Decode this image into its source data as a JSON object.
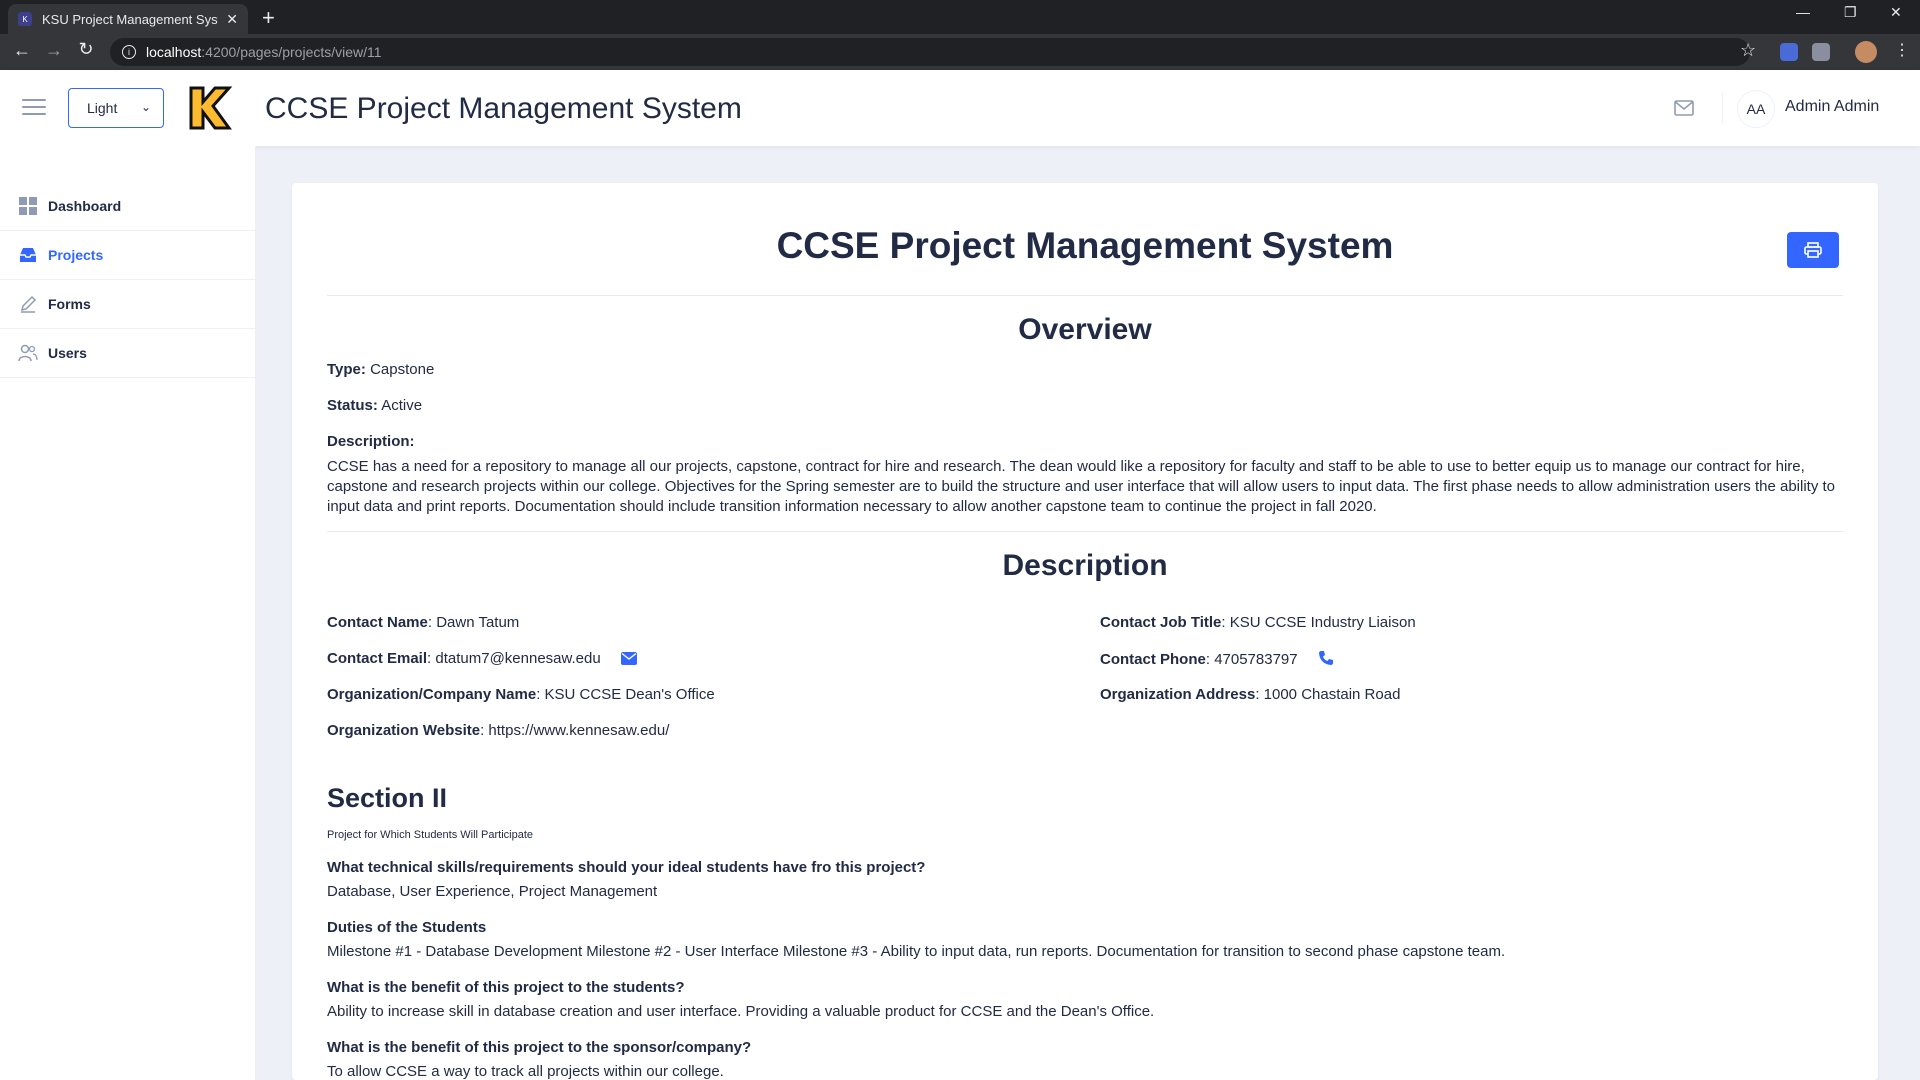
{
  "browser": {
    "tab_title": "KSU Project Management System",
    "url_host": "localhost",
    "url_path": ":4200/pages/projects/view/11"
  },
  "header": {
    "theme_value": "Light",
    "app_title": "CCSE Project Management System",
    "user_initials": "AA",
    "user_name": "Admin Admin"
  },
  "sidebar": {
    "items": [
      {
        "label": "Dashboard",
        "icon": "grid-icon"
      },
      {
        "label": "Projects",
        "icon": "inbox-icon"
      },
      {
        "label": "Forms",
        "icon": "edit-icon"
      },
      {
        "label": "Users",
        "icon": "people-icon"
      }
    ]
  },
  "project": {
    "title": "CCSE Project Management System",
    "overview_heading": "Overview",
    "type_label": "Type:",
    "type_value": "Capstone",
    "status_label": "Status:",
    "status_value": "Active",
    "description_label": "Description:",
    "description_text": "CCSE has a need for a repository to manage all our projects, capstone, contract for hire and research. The dean would like a repository for faculty and staff to be able to use to better equip us to manage our contract for hire, capstone and research projects within our college. Objectives for the Spring semester are to build the structure and user interface that will allow users to input data. The first phase needs to allow administration users the ability to input data and print reports. Documentation should include transition information necessary to allow another capstone team to continue the project in fall 2020.",
    "description_heading": "Description",
    "contact": {
      "name_label": "Contact Name",
      "name_value": "Dawn Tatum",
      "job_label": "Contact Job Title",
      "job_value": "KSU CCSE Industry Liaison",
      "email_label": "Contact Email",
      "email_value": "dtatum7@kennesaw.edu",
      "phone_label": "Contact Phone",
      "phone_value": "4705783797",
      "org_label": "Organization/Company Name",
      "org_value": "KSU CCSE Dean's Office",
      "address_label": "Organization Address",
      "address_value": "1000 Chastain Road",
      "website_label": "Organization Website",
      "website_value": "https://www.kennesaw.edu/"
    },
    "section2": {
      "heading": "Section II",
      "subheading": "Project for Which Students Will Participate",
      "qa": [
        {
          "q": "What technical skills/requirements should your ideal students have fro this project?",
          "a": "Database, User Experience, Project Management"
        },
        {
          "q": "Duties of the Students",
          "a": "Milestone #1 - Database Development Milestone #2 - User Interface Milestone #3 - Ability to input data, run reports. Documentation for transition to second phase capstone team."
        },
        {
          "q": "What is the benefit of this project to the students?",
          "a": "Ability to increase skill in database creation and user interface. Providing a valuable product for CCSE and the Dean's Office."
        },
        {
          "q": "What is the benefit of this project to the sponsor/company?",
          "a": "To allow CCSE a way to track all projects within our college."
        }
      ]
    }
  },
  "colors": {
    "primary": "#3366ff",
    "text": "#222b45",
    "background": "#edf1f7"
  }
}
